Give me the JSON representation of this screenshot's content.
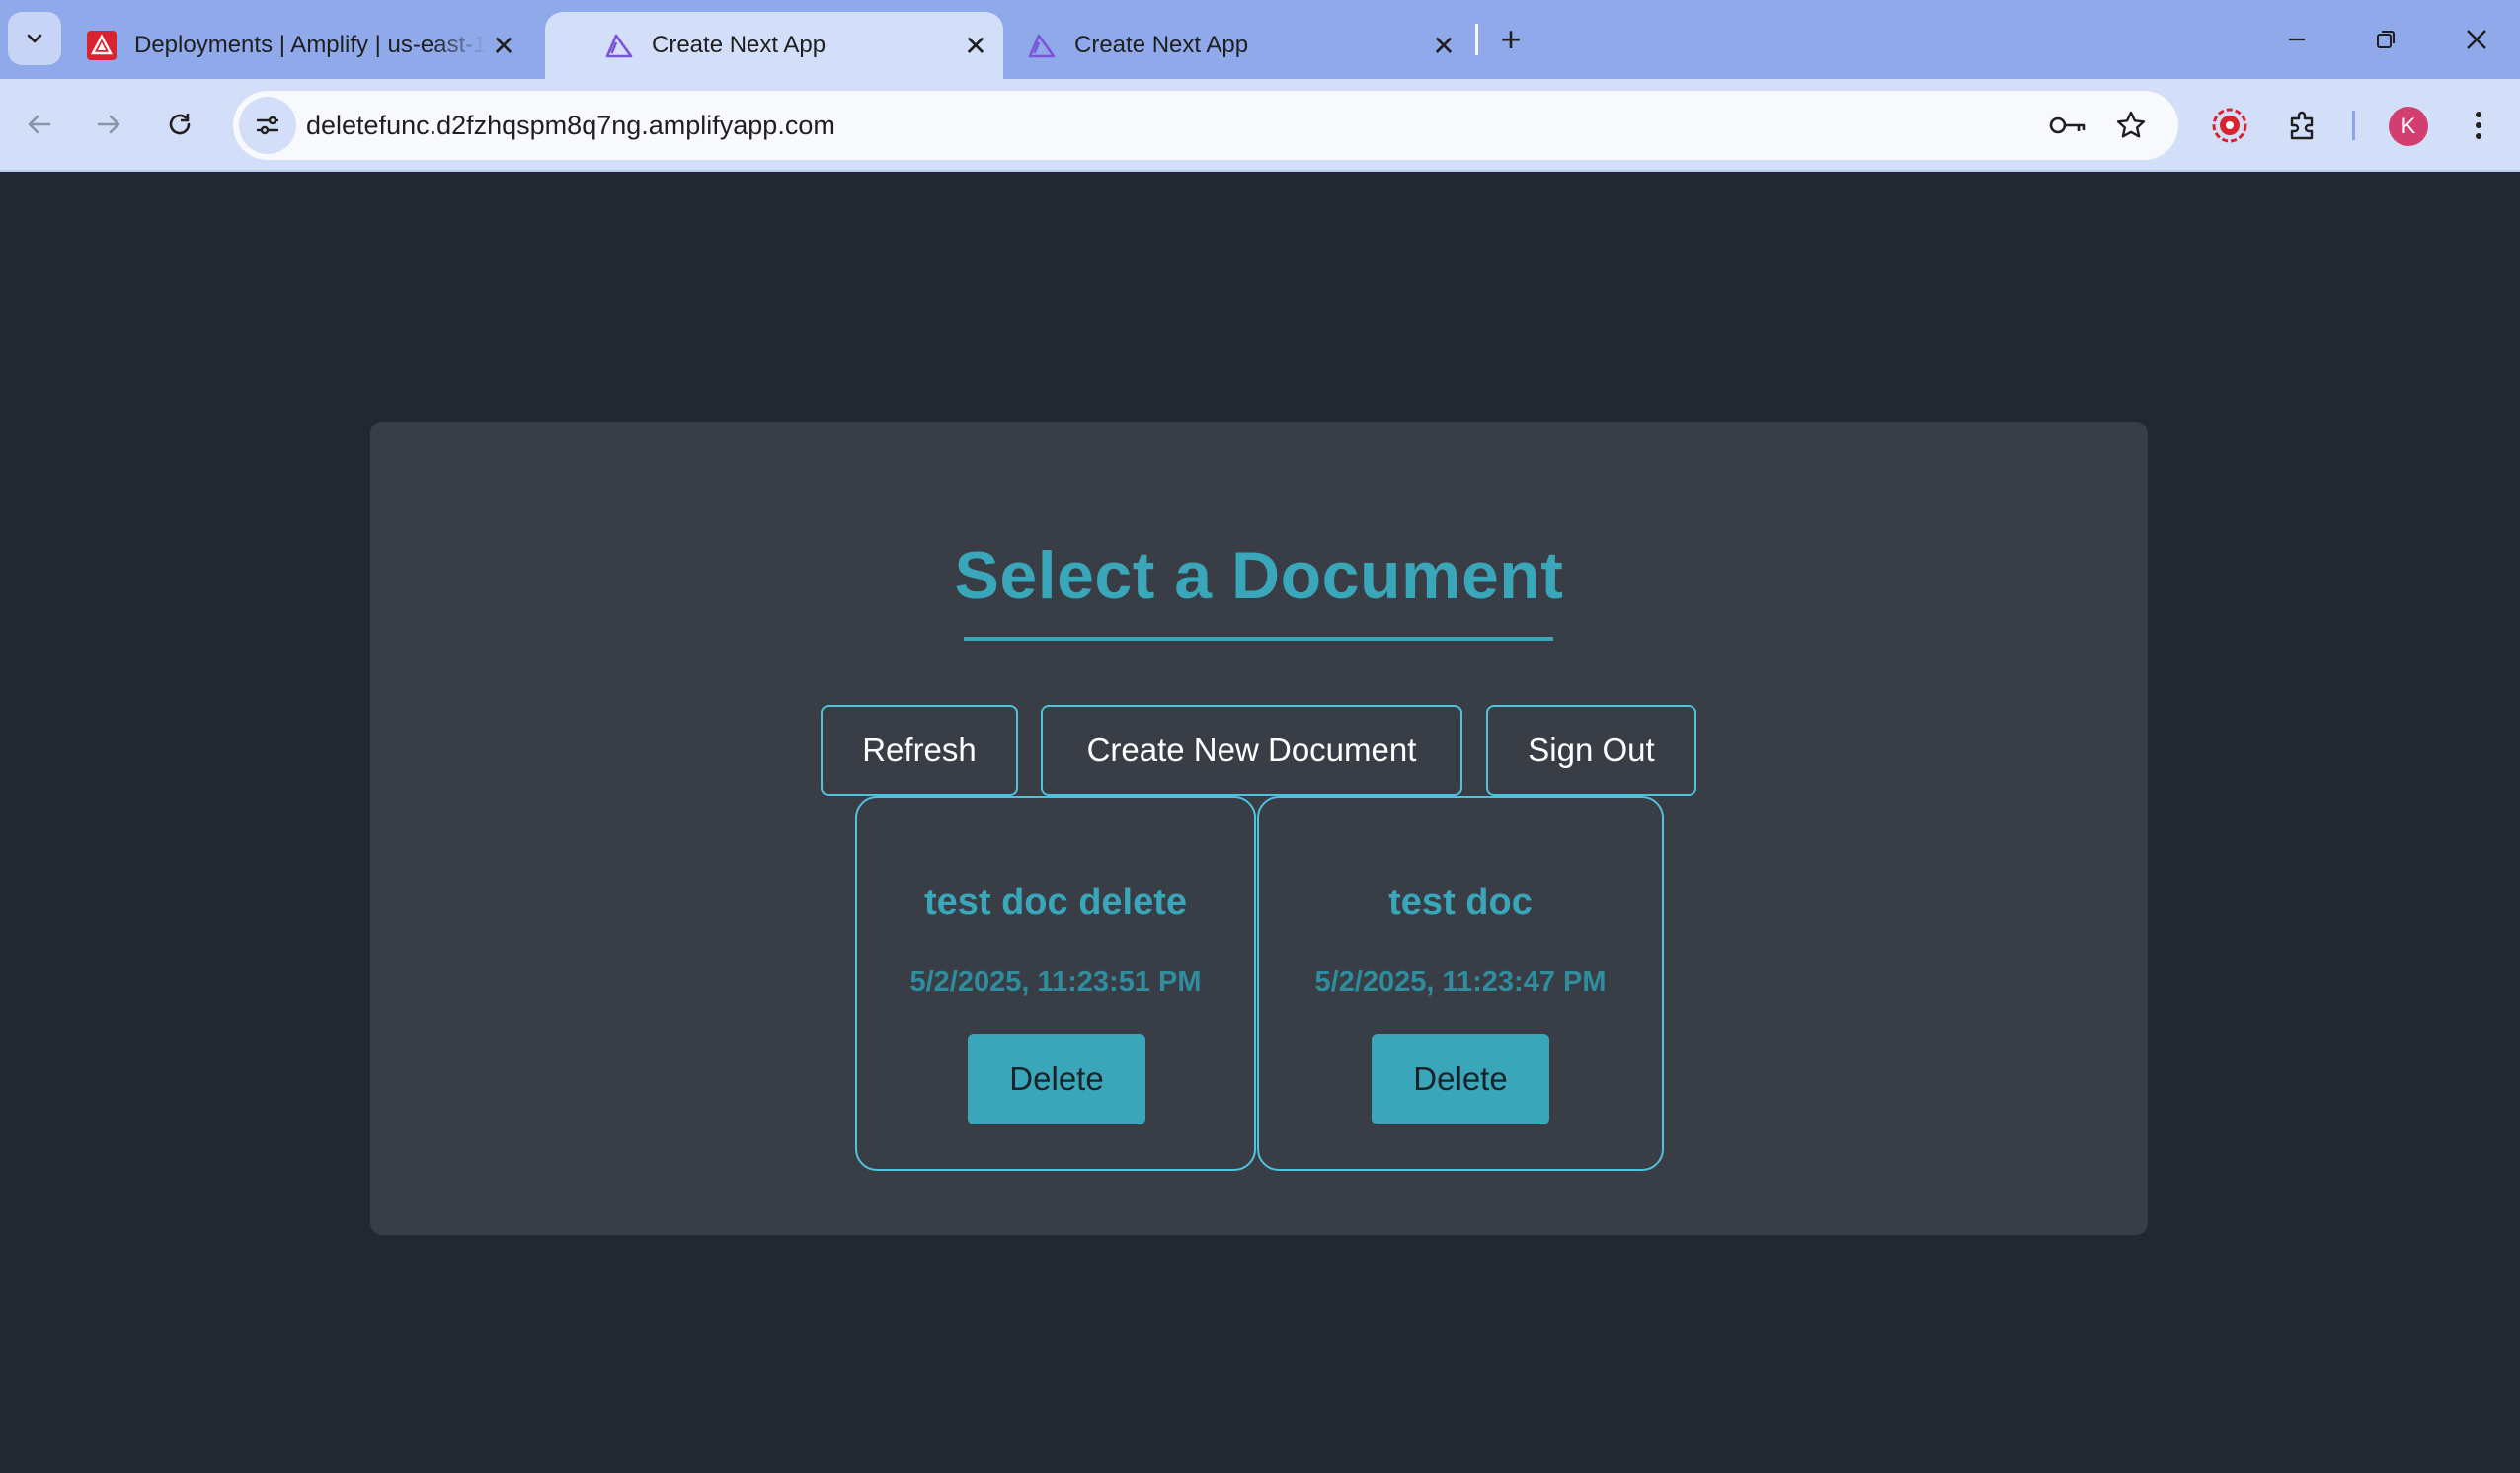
{
  "browser": {
    "tabs": [
      {
        "title": "Deployments | Amplify | us-east-1",
        "favicon": "aws-amplify-icon",
        "active": false
      },
      {
        "title": "Create Next App",
        "favicon": "amplify-logo-icon",
        "active": true
      },
      {
        "title": "Create Next App",
        "favicon": "amplify-logo-icon",
        "active": false
      }
    ],
    "url": "deletefunc.d2fzhqspm8q7ng.amplifyapp.com",
    "profile_initial": "K",
    "colors": {
      "tabbar": "#8fa9ea",
      "toolbar": "#d3def8",
      "avatar": "#d23e6f"
    }
  },
  "page": {
    "title": "Select a Document",
    "actions": {
      "refresh": "Refresh",
      "create": "Create New Document",
      "sign_out": "Sign Out"
    },
    "documents": [
      {
        "title": "test doc delete",
        "date": "5/2/2025, 11:23:51 PM",
        "delete_label": "Delete"
      },
      {
        "title": "test doc",
        "date": "5/2/2025, 11:23:47 PM",
        "delete_label": "Delete"
      }
    ],
    "colors": {
      "background": "#23272f",
      "panel": "#393d46",
      "accent": "#3aa6b9",
      "border": "#4fc3dd"
    }
  }
}
